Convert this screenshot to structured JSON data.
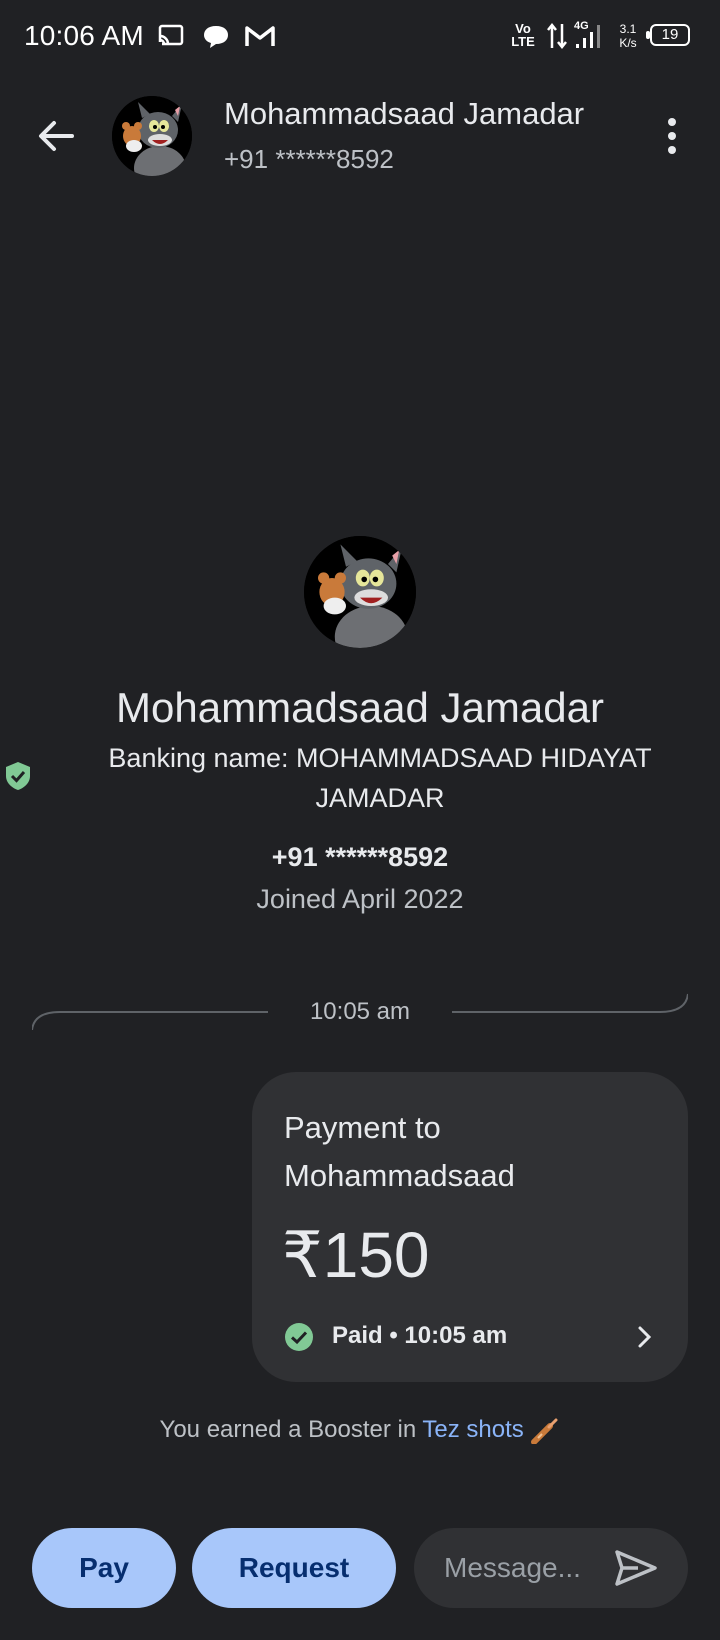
{
  "status_bar": {
    "time": "10:06 AM",
    "volte_top": "Vo",
    "volte_bottom": "LTE",
    "network": "4G",
    "speed_value": "3.1",
    "speed_unit": "K/s",
    "battery": "19"
  },
  "header": {
    "name": "Mohammadsaad Jamadar",
    "phone": "+91 ******8592"
  },
  "profile": {
    "name": "Mohammadsaad Jamadar",
    "banking_name": "Banking name: MOHAMMADSAAD HIDAYAT JAMADAR",
    "phone": "+91 ******8592",
    "joined": "Joined April 2022"
  },
  "conversation": {
    "divider_time": "10:05 am",
    "payment": {
      "title": "Payment to Mohammadsaad",
      "amount": "₹150",
      "status": "Paid • 10:05 am"
    },
    "booster_prefix": "You earned a Booster in ",
    "booster_link": "Tez shots"
  },
  "bottom_bar": {
    "pay_label": "Pay",
    "request_label": "Request",
    "message_placeholder": "Message..."
  },
  "colors": {
    "background": "#202124",
    "card": "#303134",
    "button": "#a8c7fa",
    "button_text": "#062e6f",
    "link": "#8ab4f8",
    "paid_green": "#81c995"
  },
  "icons": [
    "back-arrow-icon",
    "more-vert-icon",
    "verified-shield-icon",
    "check-circle-icon",
    "chevron-right-icon",
    "send-icon",
    "cricket-bat-icon"
  ]
}
